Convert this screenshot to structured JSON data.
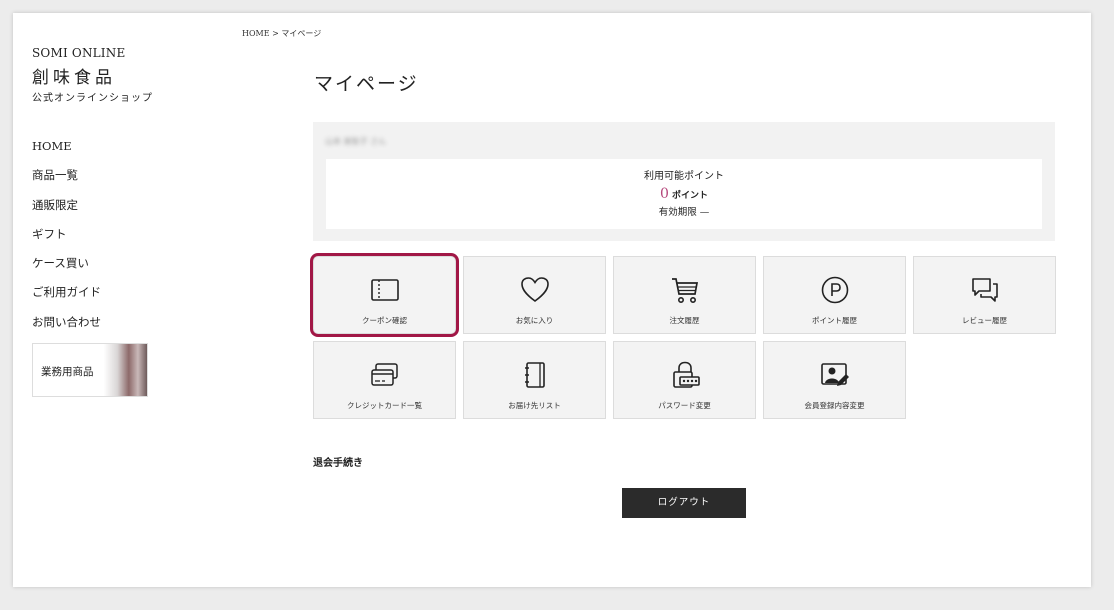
{
  "breadcrumb": "HOME > マイページ",
  "brand": {
    "en": "SOMI ONLINE",
    "jp": "創味食品",
    "sub": "公式オンラインショップ"
  },
  "nav": {
    "items": [
      {
        "label": "HOME"
      },
      {
        "label": "商品一覧"
      },
      {
        "label": "通販限定"
      },
      {
        "label": "ギフト"
      },
      {
        "label": "ケース買い"
      },
      {
        "label": "ご利用ガイド"
      },
      {
        "label": "お問い合わせ"
      }
    ],
    "business_label": "業務用商品"
  },
  "page_title": "マイページ",
  "points": {
    "user_name": "山本 美智子 さん",
    "label": "利用可能ポイント",
    "value": "0",
    "unit": "ポイント",
    "expiry": "有効期限 —"
  },
  "tiles": [
    {
      "label": "クーポン確認",
      "icon": "coupon-book-icon",
      "highlighted": true
    },
    {
      "label": "お気に入り",
      "icon": "heart-icon",
      "highlighted": false
    },
    {
      "label": "注文履歴",
      "icon": "cart-icon",
      "highlighted": false
    },
    {
      "label": "ポイント履歴",
      "icon": "points-p-icon",
      "highlighted": false
    },
    {
      "label": "レビュー履歴",
      "icon": "chat-bubbles-icon",
      "highlighted": false
    },
    {
      "label": "クレジットカード一覧",
      "icon": "credit-card-icon",
      "highlighted": false
    },
    {
      "label": "お届け先リスト",
      "icon": "address-book-icon",
      "highlighted": false
    },
    {
      "label": "パスワード変更",
      "icon": "password-lock-icon",
      "highlighted": false
    },
    {
      "label": "会員登録内容変更",
      "icon": "profile-edit-icon",
      "highlighted": false
    }
  ],
  "withdraw_label": "退会手続き",
  "logout_label": "ログアウト",
  "colors": {
    "highlight": "#a11746",
    "points_value": "#b4457a",
    "logout_bg": "#2b2b2b",
    "tile_bg": "#f3f3f3"
  }
}
